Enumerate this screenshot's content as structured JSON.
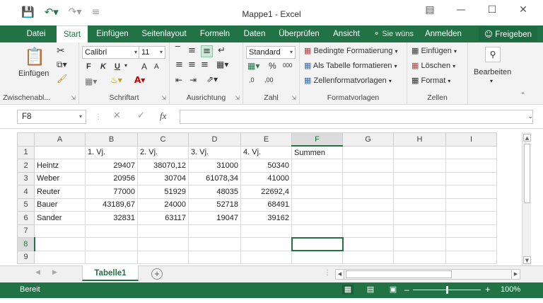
{
  "window": {
    "title": "Mappe1 - Excel",
    "qat": {
      "save_icon": "save-icon",
      "undo_icon": "undo-icon",
      "redo_icon": "redo-icon",
      "customize_icon": "customize-qat-icon"
    }
  },
  "tabs": [
    {
      "label": "Datei"
    },
    {
      "label": "Start"
    },
    {
      "label": "Einfügen"
    },
    {
      "label": "Seitenlayout"
    },
    {
      "label": "Formeln"
    },
    {
      "label": "Daten"
    },
    {
      "label": "Überprüfen"
    },
    {
      "label": "Ansicht"
    }
  ],
  "tellme": "Sie wüns",
  "signin": "Anmelden",
  "share": "Freigeben",
  "ribbon": {
    "clipboard": {
      "paste": "Einfügen",
      "label": "Zwischenabl..."
    },
    "font": {
      "name": "Calibri",
      "size": "11",
      "bold": "F",
      "italic": "K",
      "underline": "U",
      "grow": "A",
      "shrink": "A",
      "label": "Schriftart"
    },
    "alignment": {
      "label": "Ausrichtung"
    },
    "number": {
      "format": "Standard",
      "percent": "%",
      "thousands": "000",
      "dec_inc": ",0",
      "dec_dec": ",00",
      "label": "Zahl"
    },
    "styles": {
      "conditional": "Bedingte Formatierung",
      "table": "Als Tabelle formatieren",
      "cell": "Zellenformatvorlagen",
      "label": "Formatvorlagen"
    },
    "cells": {
      "insert": "Einfügen",
      "delete": "Löschen",
      "format": "Format",
      "label": "Zellen"
    },
    "editing": {
      "label": "Bearbeiten"
    }
  },
  "formula_bar": {
    "name_box": "F8",
    "formula": ""
  },
  "grid": {
    "columns": [
      "A",
      "B",
      "C",
      "D",
      "E",
      "F",
      "G",
      "H",
      "I"
    ],
    "rows": [
      {
        "num": "1",
        "cells": [
          "",
          "1. Vj.",
          "2. Vj.",
          "3. Vj.",
          "4. Vj.",
          "Summen",
          "",
          "",
          ""
        ]
      },
      {
        "num": "2",
        "cells": [
          "Heintz",
          "29407",
          "38070,12",
          "31000",
          "50340",
          "",
          "",
          "",
          ""
        ]
      },
      {
        "num": "3",
        "cells": [
          "Weber",
          "20956",
          "30704",
          "61078,34",
          "41000",
          "",
          "",
          "",
          ""
        ]
      },
      {
        "num": "4",
        "cells": [
          "Reuter",
          "77000",
          "51929",
          "48035",
          "22692,4",
          "",
          "",
          "",
          ""
        ]
      },
      {
        "num": "5",
        "cells": [
          "Bauer",
          "43189,67",
          "24000",
          "52718",
          "68491",
          "",
          "",
          "",
          ""
        ]
      },
      {
        "num": "6",
        "cells": [
          "Sander",
          "32831",
          "63117",
          "19047",
          "39162",
          "",
          "",
          "",
          ""
        ]
      },
      {
        "num": "7",
        "cells": [
          "",
          "",
          "",
          "",
          "",
          "",
          "",
          "",
          ""
        ]
      },
      {
        "num": "8",
        "cells": [
          "",
          "",
          "",
          "",
          "",
          "",
          "",
          "",
          ""
        ]
      },
      {
        "num": "9",
        "cells": [
          "",
          "",
          "",
          "",
          "",
          "",
          "",
          "",
          ""
        ]
      }
    ],
    "selected_cell": "F8"
  },
  "sheet_tabs": [
    {
      "label": "Tabelle1"
    }
  ],
  "status": {
    "ready": "Bereit",
    "zoom": "100%",
    "zoom_fraction": 0.5
  },
  "colors": {
    "accent": "#217346"
  }
}
